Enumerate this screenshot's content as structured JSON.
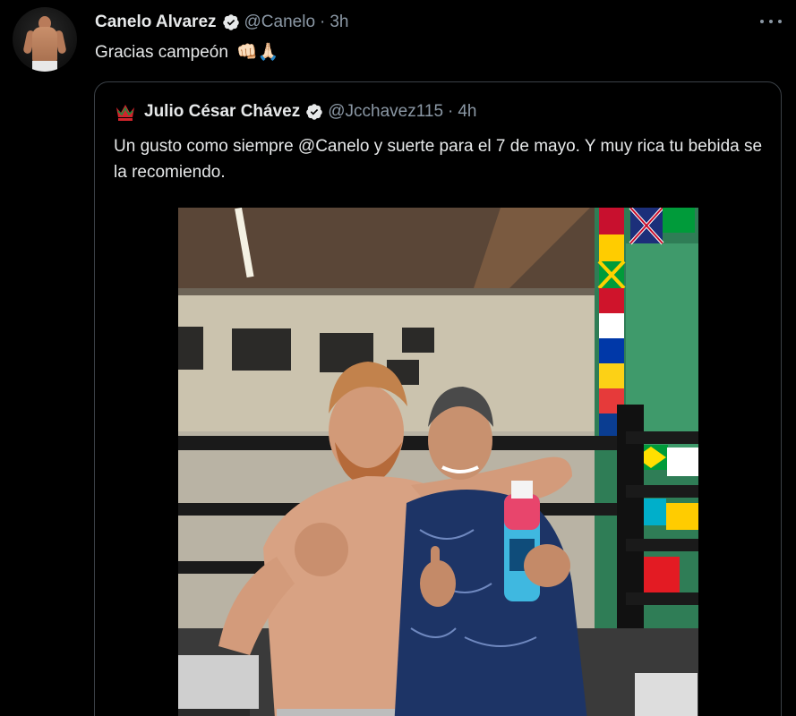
{
  "tweet": {
    "author_name": "Canelo Alvarez",
    "author_handle": "@Canelo",
    "time": "3h",
    "text": "Gracias campeón",
    "emojis": "👊🏻🙏🏻"
  },
  "quoted_tweet": {
    "author_name": "Julio César Chávez",
    "author_handle": "@Jcchavez115",
    "time": "4h",
    "text": "Un gusto como siempre @Canelo y suerte para el 7 de mayo. Y muy rica tu bebida se la recomiendo."
  },
  "colors": {
    "background": "#000000",
    "text_primary": "#e7e9ea",
    "text_secondary": "#8b98a5",
    "border": "#3b4147",
    "verified": "#e7e9ea"
  },
  "icons": {
    "verified": "verified-badge-icon",
    "more": "more-dots-icon",
    "quoted_avatar": "crown-logo"
  }
}
